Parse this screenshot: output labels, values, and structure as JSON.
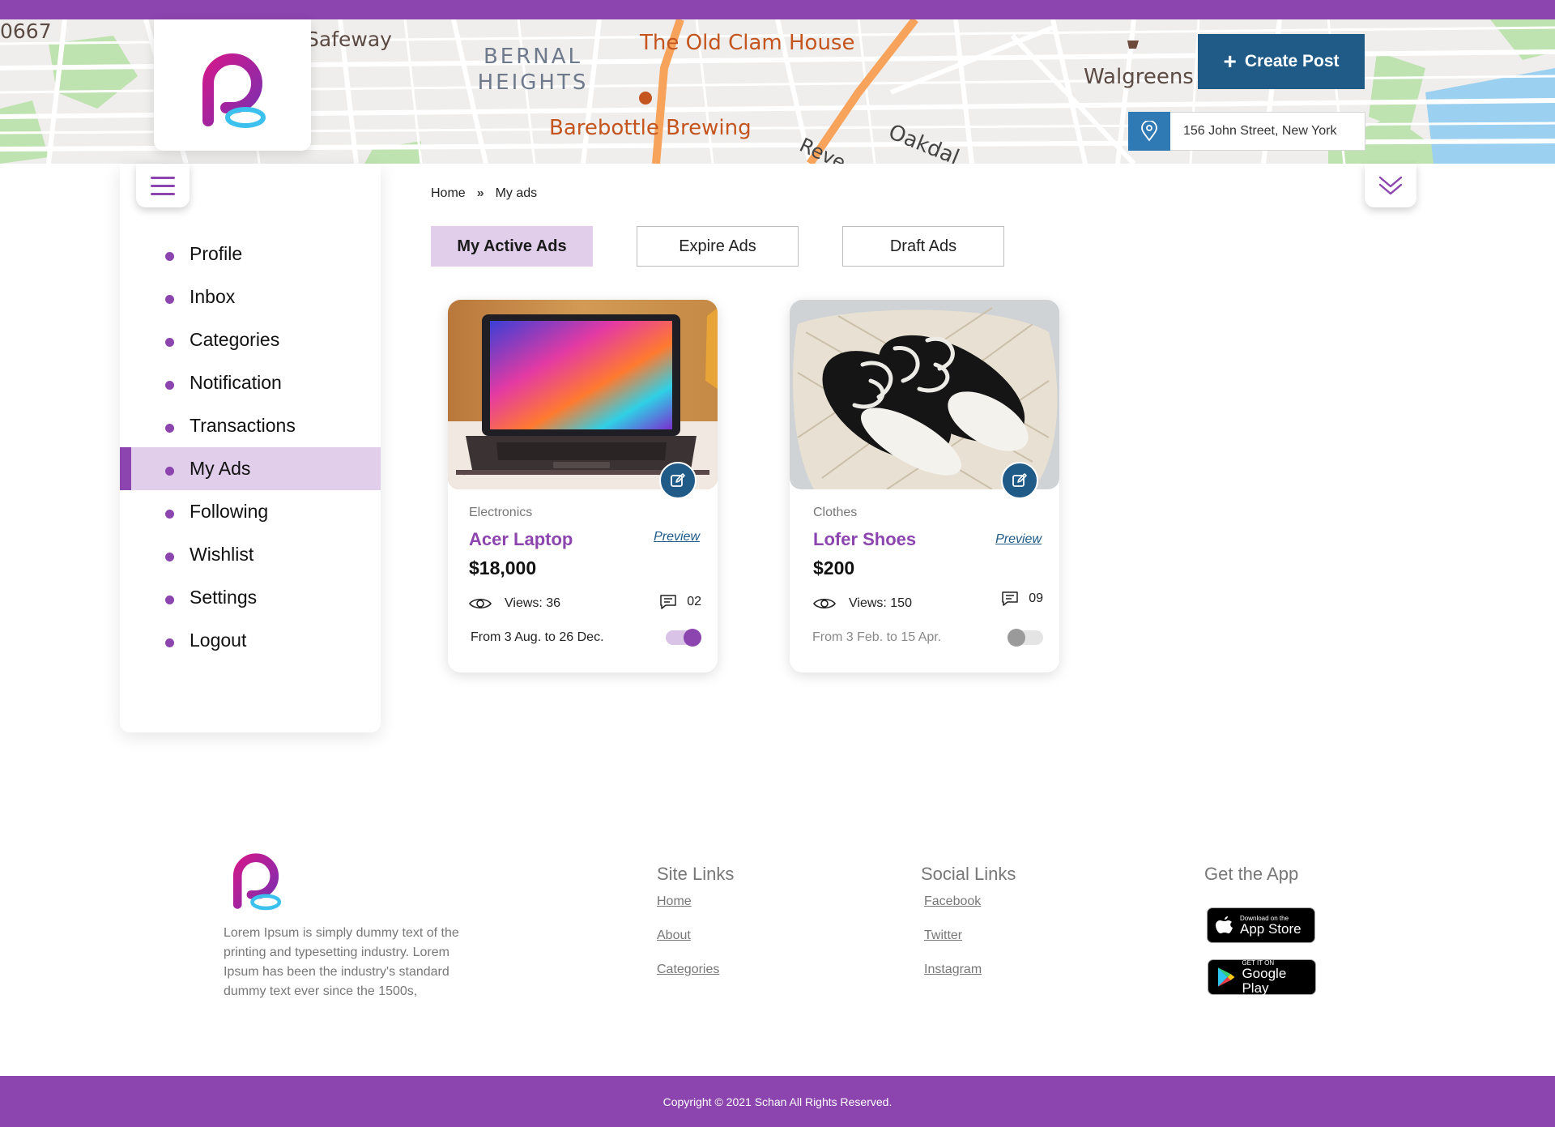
{
  "header": {
    "create_post_label": "Create Post",
    "location": "156 John Street, New York",
    "map_labels": {
      "safeway": "Safeway",
      "bernal": "BERNAL HEIGHTS",
      "clam": "The Old Clam House",
      "barebottle": "Barebottle Brewing",
      "walgreens": "Walgreens",
      "oakdal": "Oakdal",
      "reve": "Reve",
      "num": "0667"
    }
  },
  "sidebar": {
    "items": [
      {
        "label": "Profile"
      },
      {
        "label": "Inbox"
      },
      {
        "label": "Categories"
      },
      {
        "label": "Notification"
      },
      {
        "label": "Transactions"
      },
      {
        "label": "My Ads"
      },
      {
        "label": "Following"
      },
      {
        "label": "Wishlist"
      },
      {
        "label": "Settings"
      },
      {
        "label": "Logout"
      }
    ],
    "active": "My Ads"
  },
  "breadcrumb": {
    "home": "Home",
    "current": "My ads"
  },
  "tabs": [
    {
      "label": "My Active Ads"
    },
    {
      "label": "Expire Ads"
    },
    {
      "label": "Draft Ads"
    }
  ],
  "ads": [
    {
      "category": "Electronics",
      "title": "Acer Laptop",
      "preview": "Preview",
      "price": "$18,000",
      "views": "Views: 36",
      "comments": "02",
      "dates": "From 3 Aug. to 26 Dec.",
      "active": true
    },
    {
      "category": "Clothes",
      "title": "Lofer Shoes",
      "preview": "Preview",
      "price": "$200",
      "views": "Views: 150",
      "comments": "09",
      "dates": "From 3 Feb. to 15 Apr.",
      "active": false
    }
  ],
  "footer": {
    "about": "Lorem Ipsum is simply dummy text of the printing and typesetting industry. Lorem Ipsum has been the industry's standard dummy text ever since the 1500s,",
    "site_links_title": "Site Links",
    "site_links": [
      "Home",
      "About",
      "Categories"
    ],
    "social_links_title": "Social Links",
    "social_links": [
      "Facebook",
      "Twitter",
      "Instagram"
    ],
    "app_title": "Get the App",
    "appstore_small": "Download on the",
    "appstore_big": "App Store",
    "gplay_small": "GET IT ON",
    "gplay_big": "Google Play",
    "copyright": "Copyright © 2021 Schan All Rights Reserved."
  },
  "colors": {
    "brand_purple": "#8c44ae",
    "brand_blue": "#205b88",
    "active_tint": "#e0ceea"
  }
}
